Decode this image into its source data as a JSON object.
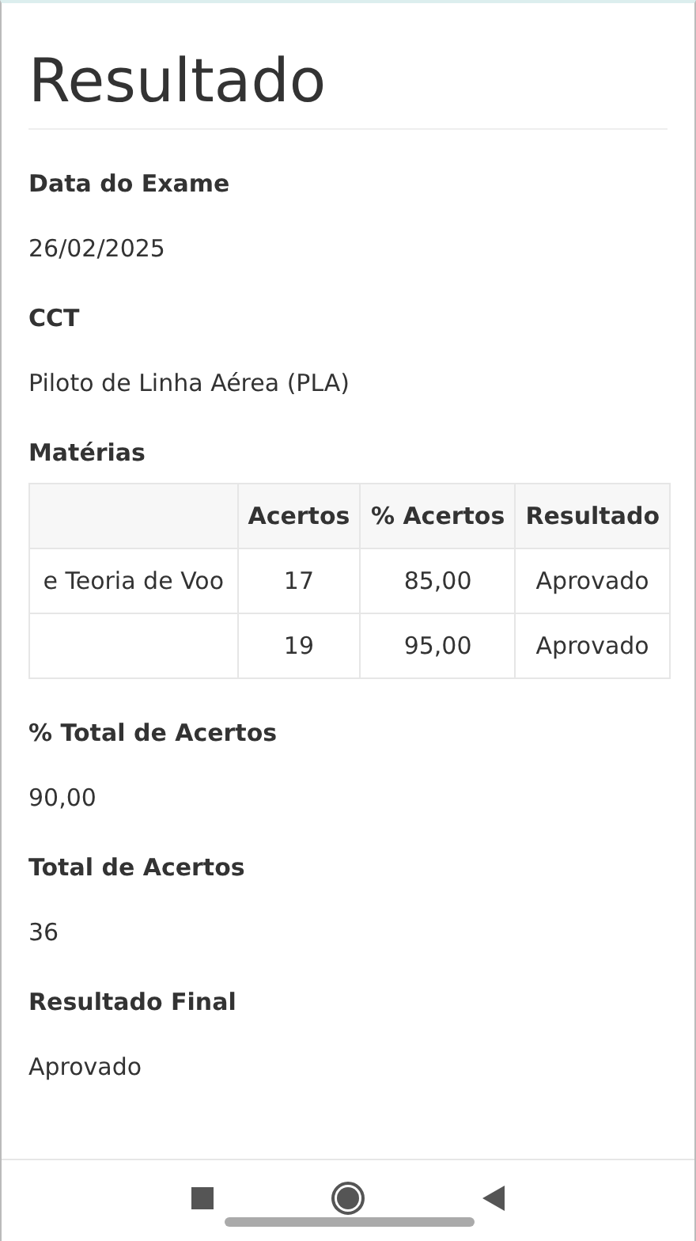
{
  "title": "Resultado",
  "sections": [
    {
      "kind": "field",
      "label": "Data do Exame",
      "value": "26/02/2025"
    },
    {
      "kind": "field",
      "label": "CCT",
      "value": "Piloto de Linha Aérea (PLA)"
    },
    {
      "kind": "table",
      "label": "Matérias",
      "columns": [
        "",
        "Acertos",
        "% Acertos",
        "Resultado"
      ],
      "rows": [
        [
          "e Teoria de Voo",
          "17",
          "85,00",
          "Aprovado"
        ],
        [
          "",
          "19",
          "95,00",
          "Aprovado"
        ]
      ]
    },
    {
      "kind": "field",
      "label": "% Total de Acertos",
      "value": "90,00"
    },
    {
      "kind": "field",
      "label": "Total de Acertos",
      "value": "36"
    },
    {
      "kind": "field",
      "label": "Resultado Final",
      "value": "Aprovado"
    }
  ]
}
